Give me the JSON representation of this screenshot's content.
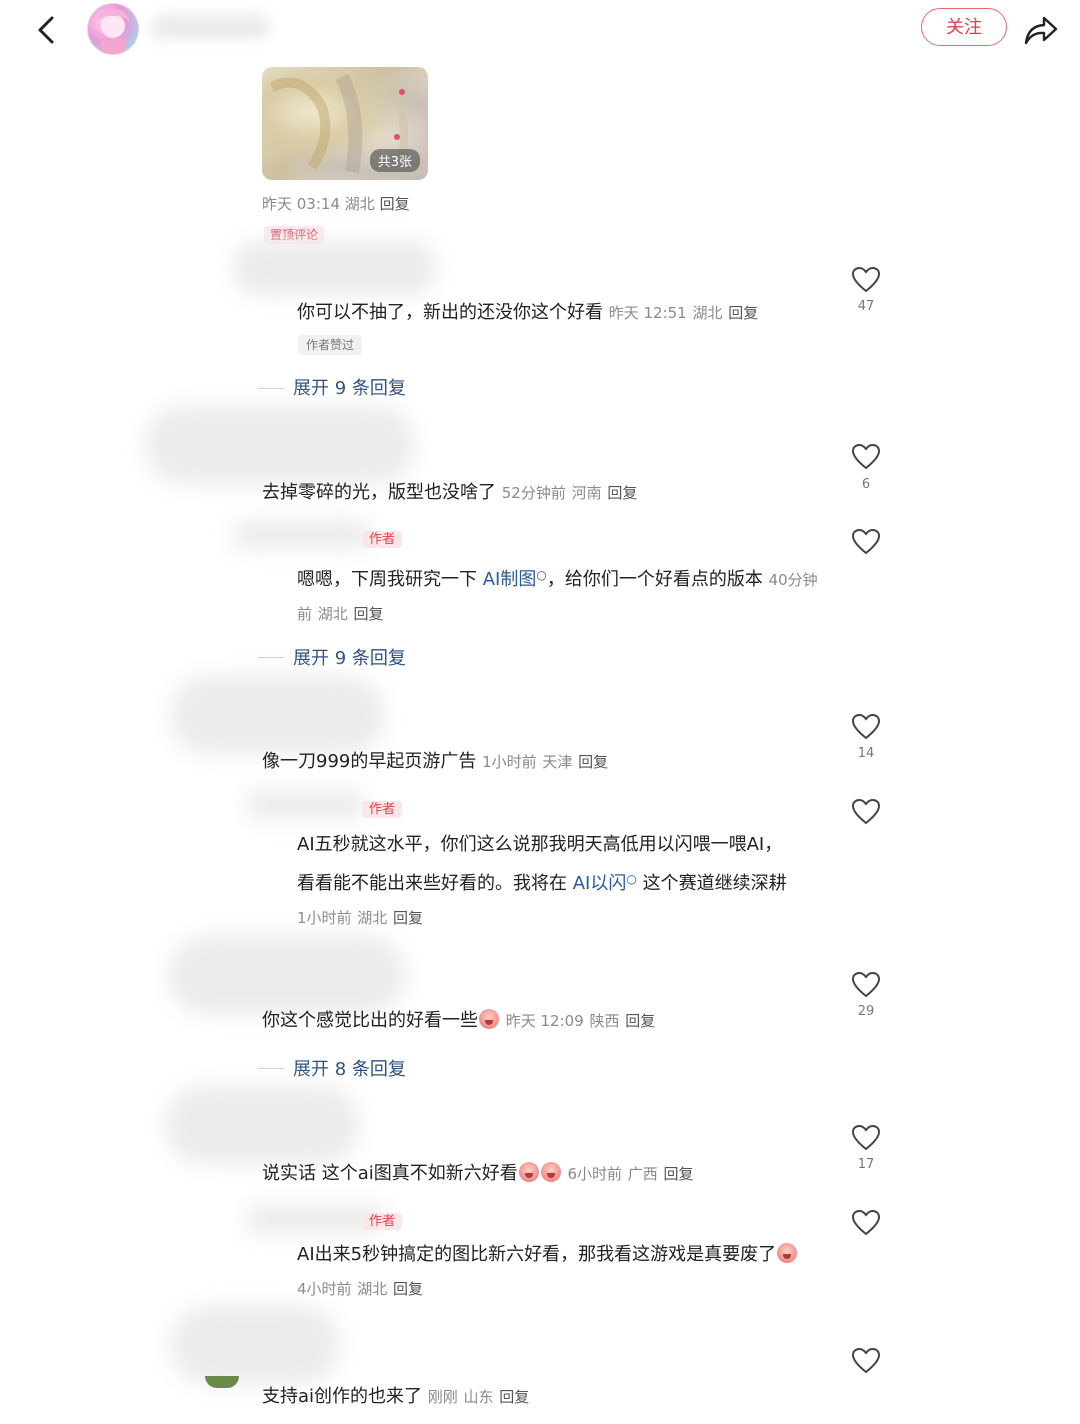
{
  "header": {
    "follow_label": "关注"
  },
  "post": {
    "image_count_label": "共3张",
    "meta": {
      "time": "昨天 03:14",
      "location": "湖北",
      "reply": "回复"
    },
    "pinned_label": "置顶评论"
  },
  "comments": [
    {
      "text": "你可以不抽了，新出的还没你这个好看",
      "time": "昨天 12:51",
      "location": "湖北",
      "reply": "回复",
      "liked_by_author": "作者赞过",
      "likes": "47",
      "expand": "展开 9 条回复"
    },
    {
      "text": "去掉零碎的光，版型也没啥了",
      "time": "52分钟前",
      "location": "河南",
      "reply": "回复",
      "likes": "6",
      "reply_item": {
        "author_tag": "作者",
        "text_a": "嗯嗯，下周我研究一下 ",
        "link": "AI制图",
        "text_b": "，给你们一个好看点的版本 ",
        "time": "40分钟前",
        "location": "湖北",
        "reply": "回复"
      },
      "expand": "展开 9 条回复"
    },
    {
      "text": "像一刀999的早起页游广告",
      "time": "1小时前",
      "location": "天津",
      "reply": "回复",
      "likes": "14",
      "reply_item": {
        "author_tag": "作者",
        "line1": "AI五秒就这水平，你们这么说那我明天高低用以闪喂一喂AI，",
        "line2_a": "看看能不能出来些好看的。我将在 ",
        "link": "AI以闪",
        "line2_b": " 这个赛道继续深耕 ",
        "time": "1小时前",
        "location": "湖北",
        "reply": "回复"
      }
    },
    {
      "text": "你这个感觉比出的好看一些",
      "time": "昨天 12:09",
      "location": "陕西",
      "reply": "回复",
      "likes": "29",
      "expand": "展开 8 条回复"
    },
    {
      "text": "说实话 这个ai图真不如新六好看",
      "time": "6小时前",
      "location": "广西",
      "reply": "回复",
      "likes": "17",
      "reply_item": {
        "author_tag": "作者",
        "text": "AI出来5秒钟搞定的图比新六好看，那我看这游戏是真要废了",
        "time": "4小时前",
        "location": "湖北",
        "reply": "回复"
      }
    },
    {
      "text": "支持ai创作的也来了",
      "time": "刚刚",
      "location": "山东",
      "reply": "回复"
    }
  ],
  "colors": {
    "accent_red": "#e2404c",
    "link_blue": "#2b5b9c",
    "meta_gray": "#8a8a8a"
  },
  "icons": [
    "back-arrow-icon",
    "share-icon",
    "heart-icon"
  ]
}
